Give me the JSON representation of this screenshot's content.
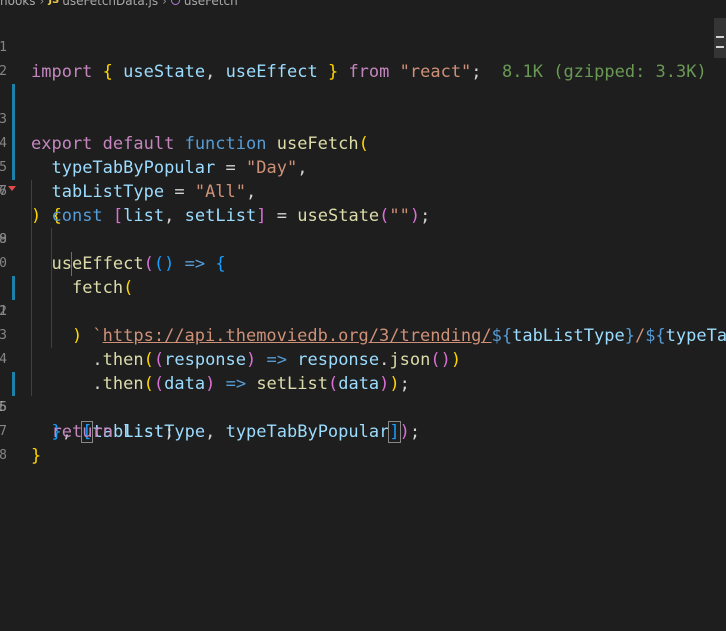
{
  "breadcrumb": {
    "folder": "hooks",
    "file_icon": "JS",
    "file": "useFetchData.js",
    "symbol": "useFetch"
  },
  "editor": {
    "line_numbers": [
      "1",
      "2",
      "3",
      "4",
      "5",
      "6",
      "7",
      "8",
      "9",
      "0",
      "1",
      "2",
      "3",
      "4",
      "5",
      "6",
      "7",
      "8"
    ],
    "line1": {
      "kw_import": "import",
      "b_open": "{",
      "id1": "useState",
      "comma": ",",
      "id2": "useEffect",
      "b_close": "}",
      "kw_from": "from",
      "str": "\"react\"",
      "semi": ";",
      "hint": "8.1K (gzipped: 3.3K)"
    },
    "line3": {
      "kw_export": "export",
      "kw_default": "default",
      "kw_function": "function",
      "name": "useFetch",
      "paren": "("
    },
    "line4": {
      "param": "typeTabByPopular",
      "eq": "=",
      "str": "\"Day\"",
      "comma": ","
    },
    "line5": {
      "param": "tabListType",
      "eq": "=",
      "str": "\"All\"",
      "comma": ","
    },
    "line6": {
      "paren": ")",
      "brace": "{"
    },
    "line7": {
      "kw_const": "const",
      "b_open": "[",
      "v1": "list",
      "comma": ",",
      "v2": "setList",
      "b_close": "]",
      "eq": "=",
      "fn": "useState",
      "p_open": "(",
      "str": "\"\"",
      "p_close": ")",
      "semi": ";"
    },
    "line9": {
      "fn": "useEffect",
      "p_open": "(",
      "arrow_params": "()",
      "arrow": "=>",
      "brace": "{"
    },
    "line10": {
      "fn": "fetch",
      "p_open": "("
    },
    "line11": {
      "tick": "`",
      "url": "https://api.themoviedb.org/3/trending/",
      "d1_open": "${",
      "v1": "tabListType",
      "d1_close": "}",
      "slash": "/",
      "d2_open": "${",
      "v2": "typeTab"
    },
    "line12": {
      "p_close": ")"
    },
    "line13": {
      "dot": ".",
      "fn": "then",
      "p_open": "(",
      "pp_open": "(",
      "param": "response",
      "pp_close": ")",
      "arrow": "=>",
      "obj": "response",
      "dot2": ".",
      "fn2": "json",
      "call": "()",
      "p_close": ")"
    },
    "line14": {
      "dot": ".",
      "fn": "then",
      "p_open": "(",
      "pp_open": "(",
      "param": "data",
      "pp_close": ")",
      "arrow": "=>",
      "fn2": "setList",
      "c_open": "(",
      "arg": "data",
      "c_close": ")",
      "p_close": ")",
      "semi": ";"
    },
    "line15": {
      "brace": "}",
      "comma": ",",
      "b_open": "[",
      "v1": "tabListType",
      "comma2": ",",
      "v2": "typeTabByPopular",
      "b_close": "]",
      "p_close": ")",
      "semi": ";"
    },
    "line16": {
      "kw_return": "return",
      "v": "list",
      "semi": ";"
    },
    "line17": {
      "brace": "}"
    }
  },
  "colors": {
    "background": "#1e1e1e",
    "keyword": "#569cd6",
    "control_keyword": "#c586c0",
    "function": "#dcdcaa",
    "variable": "#9cdcfe",
    "string": "#ce9178",
    "bracket_level1": "#ffd700",
    "bracket_level2": "#da70d6",
    "bracket_level3": "#179fff",
    "import_cost_hint": "#6a9955"
  }
}
